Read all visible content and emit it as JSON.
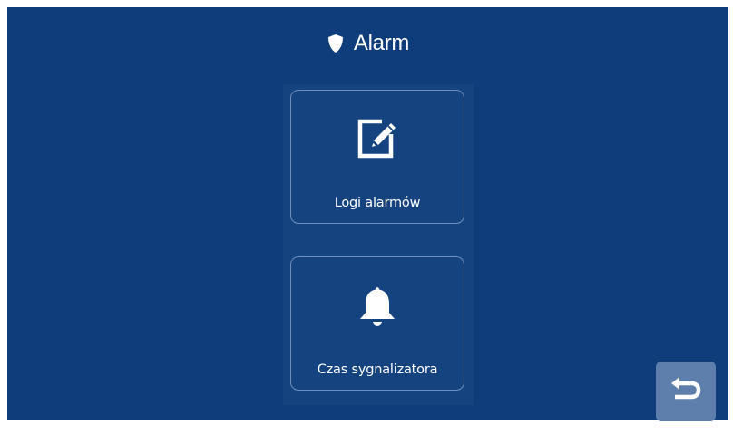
{
  "header": {
    "title": "Alarm",
    "icon": "shield-icon"
  },
  "menu": {
    "items": [
      {
        "label": "Logi alarmów",
        "icon": "edit-log-icon"
      },
      {
        "label": "Czas sygnalizatora",
        "icon": "bell-icon"
      }
    ]
  },
  "footer": {
    "back_icon": "return-arrow-icon"
  },
  "colors": {
    "background": "#0f3d7b",
    "panel": "#14437f",
    "tile_border": "#6d8dbb",
    "back_button": "#5e7fac",
    "text": "#ffffff"
  }
}
